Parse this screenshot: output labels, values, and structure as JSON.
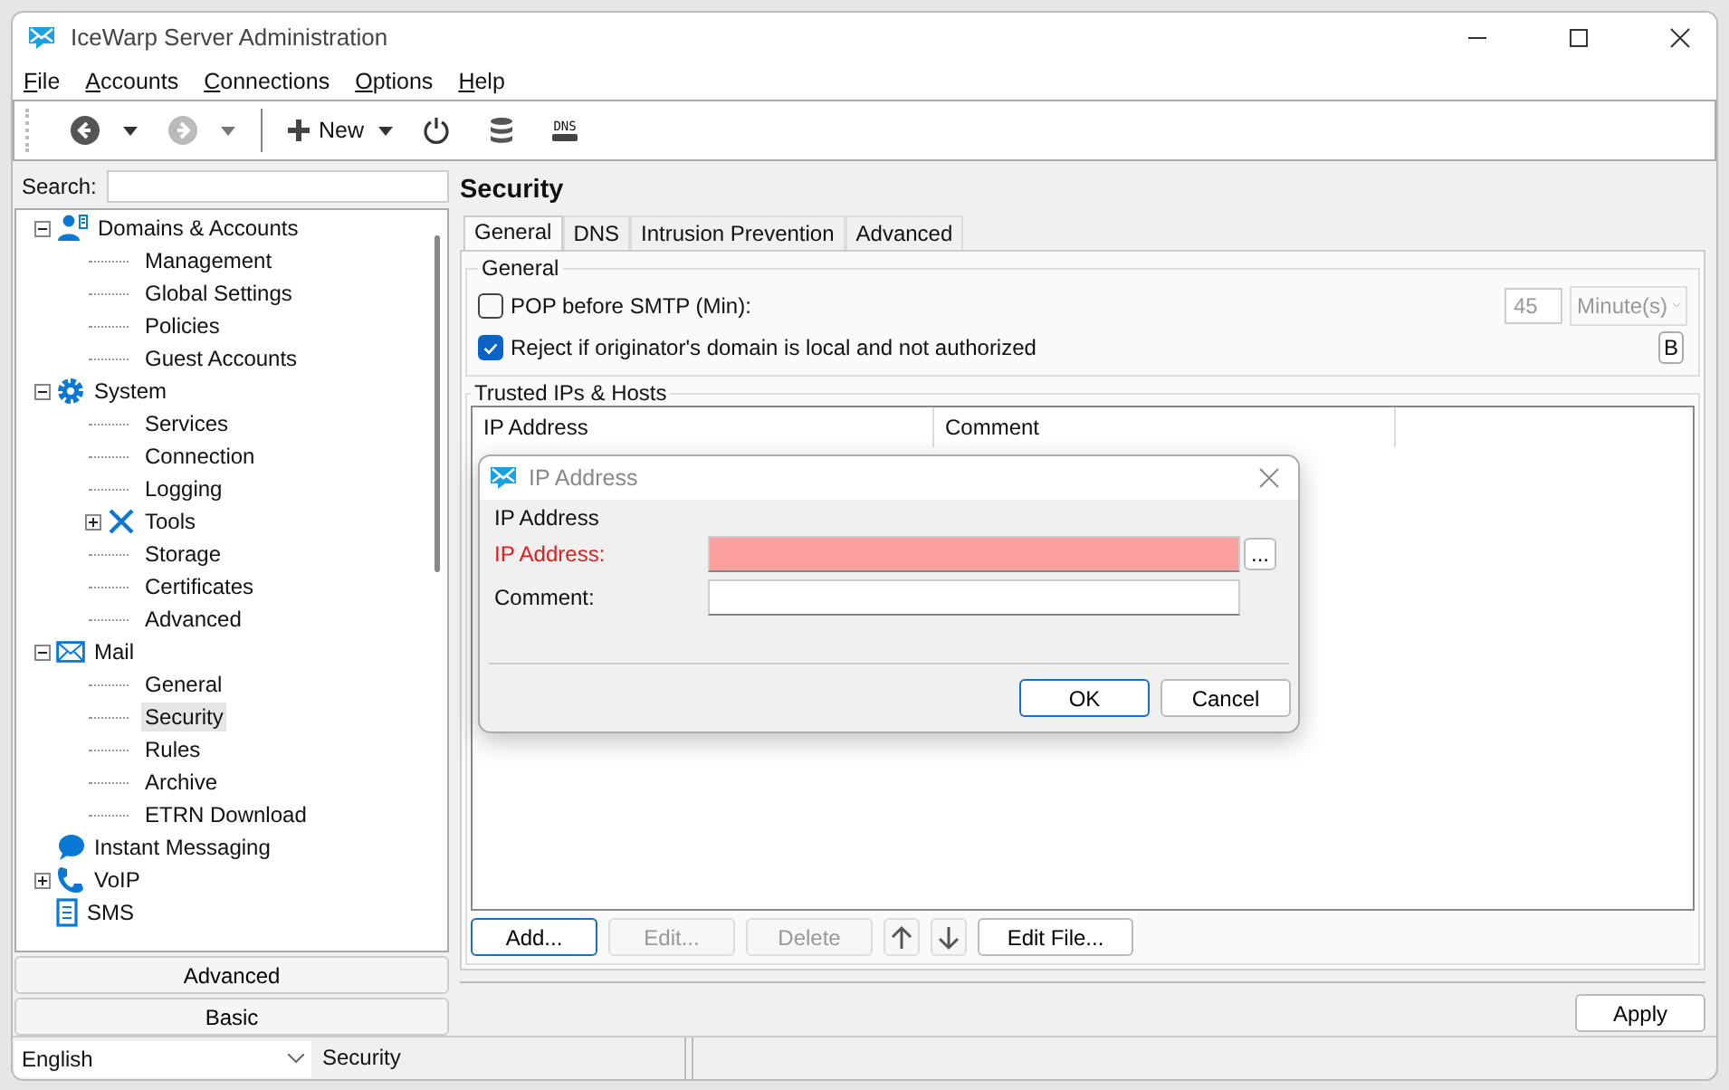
{
  "window": {
    "title": "IceWarp Server Administration"
  },
  "menu": [
    "File",
    "Accounts",
    "Connections",
    "Options",
    "Help"
  ],
  "toolbar": {
    "back": {
      "disabled": false
    },
    "forward": {
      "disabled": true
    },
    "new_label": "New",
    "dns_label": "DNS"
  },
  "sidebar": {
    "search_label": "Search:",
    "tree": [
      {
        "label": "Domains & Accounts",
        "kind": "users",
        "expanded": true,
        "selected": false,
        "children": [
          {
            "label": "Management",
            "selected": false
          },
          {
            "label": "Global Settings",
            "selected": false
          },
          {
            "label": "Policies",
            "selected": false
          },
          {
            "label": "Guest Accounts",
            "selected": false
          }
        ]
      },
      {
        "label": "System",
        "kind": "gear",
        "expanded": true,
        "selected": false,
        "children": [
          {
            "label": "Services",
            "selected": false
          },
          {
            "label": "Connection",
            "selected": false
          },
          {
            "label": "Logging",
            "selected": false
          },
          {
            "label": "Tools",
            "kind": "wrench",
            "expanded": false,
            "selected": false
          },
          {
            "label": "Storage",
            "selected": false
          },
          {
            "label": "Certificates",
            "selected": false
          },
          {
            "label": "Advanced",
            "selected": false
          }
        ]
      },
      {
        "label": "Mail",
        "kind": "envelope",
        "expanded": true,
        "selected": false,
        "children": [
          {
            "label": "General",
            "selected": false
          },
          {
            "label": "Security",
            "selected": true
          },
          {
            "label": "Rules",
            "selected": false
          },
          {
            "label": "Archive",
            "selected": false
          },
          {
            "label": "ETRN Download",
            "selected": false
          }
        ]
      },
      {
        "label": "Instant Messaging",
        "kind": "chat",
        "selected": false
      },
      {
        "label": "VoIP",
        "kind": "phone",
        "expanded": false,
        "selected": false
      },
      {
        "label": "SMS",
        "kind": "device",
        "selected": false
      }
    ],
    "buttons": [
      "Advanced",
      "Basic"
    ]
  },
  "page": {
    "title": "Security",
    "tabs": [
      {
        "label": "General",
        "selected": true
      },
      {
        "label": "DNS",
        "selected": false
      },
      {
        "label": "Intrusion Prevention",
        "selected": false
      },
      {
        "label": "Advanced",
        "selected": false
      }
    ],
    "general": {
      "legend": "General",
      "options": [
        {
          "kind": "timed",
          "label": "POP before SMTP (Min):",
          "checked": false,
          "value": "45",
          "unit": "Minute(s)"
        },
        {
          "kind": "button",
          "label": "Reject if originator's domain is local and not authorized",
          "checked": true,
          "button": "B"
        }
      ]
    },
    "trusted": {
      "legend": "Trusted IPs & Hosts",
      "columns": [
        "IP Address",
        "Comment"
      ],
      "buttons": [
        {
          "kind": "text",
          "label": "Add...",
          "disabled": false,
          "focused": true
        },
        {
          "kind": "text",
          "label": "Edit...",
          "disabled": true,
          "focused": false
        },
        {
          "kind": "text",
          "label": "Delete",
          "disabled": true,
          "focused": false
        },
        {
          "kind": "up"
        },
        {
          "kind": "down"
        },
        {
          "kind": "text",
          "label": "Edit File...",
          "disabled": false,
          "focused": false
        }
      ]
    },
    "apply": "Apply"
  },
  "dialog": {
    "title": "IP Address",
    "legend": "IP Address",
    "fields": [
      {
        "label": "IP Address:",
        "invalid": true,
        "browse": "..."
      },
      {
        "label": "Comment:",
        "invalid": false
      }
    ],
    "buttons": [
      {
        "label": "OK",
        "focused": true
      },
      {
        "label": "Cancel",
        "focused": false
      }
    ]
  },
  "status_bar": {
    "language": "English",
    "section": "Security"
  }
}
